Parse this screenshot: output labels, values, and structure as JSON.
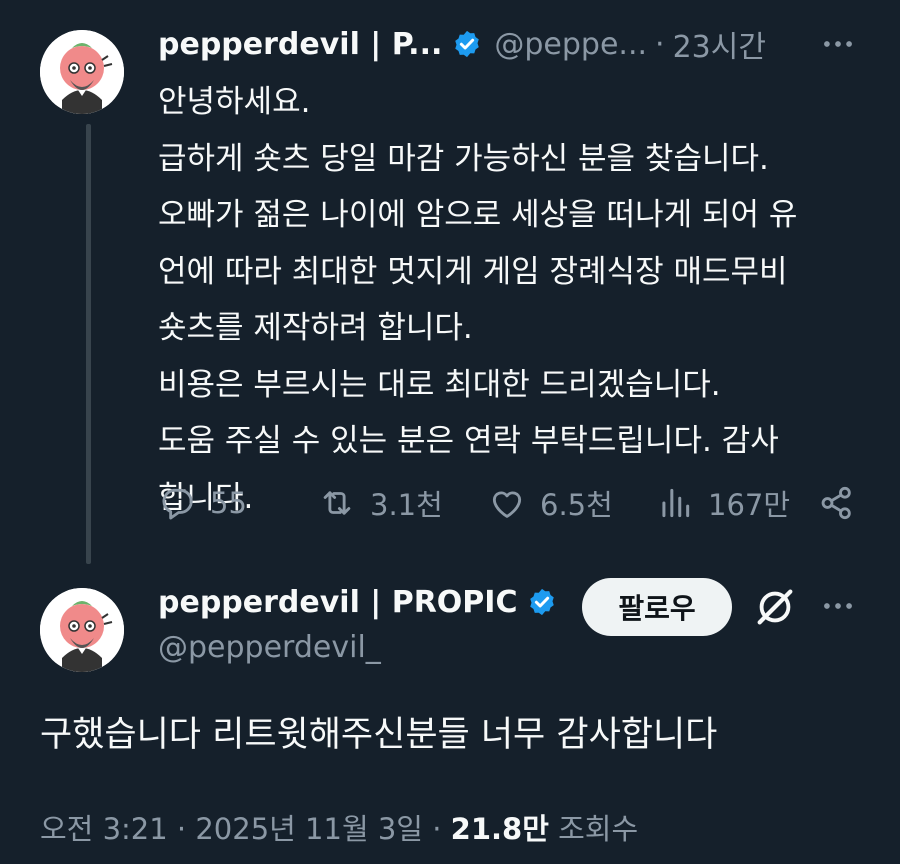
{
  "tweet1": {
    "display_name": "pepperdevil | P...",
    "handle": "@peppe...",
    "separator": "·",
    "time": "23시간",
    "body_lines": [
      "안녕하세요.",
      "급하게 숏츠 당일 마감 가능하신 분을 찾습니다.",
      "오빠가 젊은 나이에 암으로 세상을 떠나게 되어 유",
      "언에 따라 최대한 멋지게 게임 장례식장 매드무비",
      "숏츠를 제작하려 합니다.",
      "비용은 부르시는 대로 최대한 드리겠습니다.",
      "도움 주실 수 있는 분은 연락 부탁드립니다. 감사",
      "합니다."
    ],
    "replies": "55",
    "retweets": "3.1천",
    "likes": "6.5천",
    "views": "167만"
  },
  "tweet2": {
    "display_name": "pepperdevil | PROPIC",
    "handle": "@pepperdevil_",
    "follow_label": "팔로우",
    "body": "구했습니다 리트윗해주신분들 너무 감사합니다",
    "time": "오전 3:21",
    "separator": "·",
    "date": "2025년 11월 3일",
    "separator2": "·",
    "views_count": "21.8만",
    "views_label": "조회수"
  },
  "icons": {
    "verified": "verified-badge-icon",
    "more": "more-dots-icon",
    "reply": "reply-bubble-icon",
    "retweet": "retweet-icon",
    "like": "heart-icon",
    "views": "bar-chart-icon",
    "share": "share-icon",
    "grok": "grok-icon"
  },
  "colors": {
    "background": "#15202b",
    "text": "#f7f9f9",
    "secondary": "#8b98a5",
    "verified": "#1d9bf0",
    "thread_line": "#38444d",
    "follow_bg": "#eff3f4"
  }
}
